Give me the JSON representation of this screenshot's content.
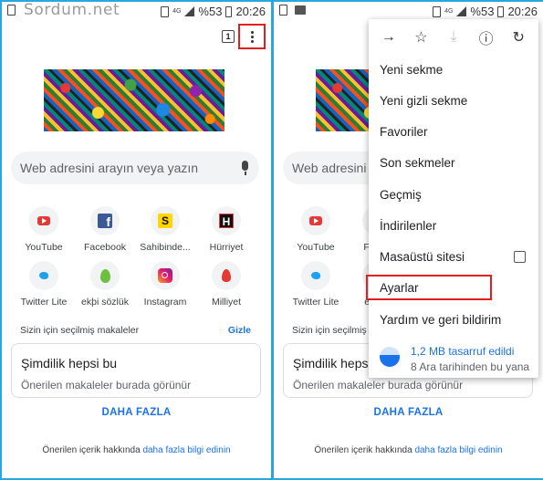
{
  "watermark": "Sordum.net",
  "status": {
    "battery_pct": "%53",
    "time": "20:26",
    "network": "4G"
  },
  "left": {
    "tab_count": "1",
    "search_placeholder": "Web adresini arayın veya yazın",
    "tiles": [
      {
        "label": "YouTube"
      },
      {
        "label": "Facebook"
      },
      {
        "label": "Sahibinde..."
      },
      {
        "label": "Hürriyet"
      },
      {
        "label": "Twitter Lite"
      },
      {
        "label": "ekþi sözlük"
      },
      {
        "label": "Instagram"
      },
      {
        "label": "Milliyet"
      }
    ],
    "section_title": "Sizin için seçilmiş makaleler",
    "hide_link": "Gizle",
    "card_title": "Şimdilik hepsi bu",
    "card_body": "Önerilen makaleler burada görünür",
    "more_button": "DAHA FAZLA",
    "footer_text": "Önerilen içerik hakkında ",
    "footer_link": "daha fazla bilgi edinin"
  },
  "right": {
    "search_placeholder": "Web adresini arayın",
    "tiles": [
      {
        "label": "YouTube"
      },
      {
        "label": "Faceb"
      },
      {
        "label": "Twitter Lite"
      },
      {
        "label": "ekþi s"
      }
    ],
    "section_title": "Sizin için seçilmiş makal",
    "card_title": "Şimdilik hepsi bu",
    "card_body": "Önerilen makaleler burada görünür",
    "more_button": "DAHA FAZLA",
    "footer_text": "Önerilen içerik hakkında ",
    "footer_link": "daha fazla bilgi edinin"
  },
  "menu": {
    "toolbar": [
      "forward-icon",
      "star-icon",
      "download-icon",
      "info-icon",
      "refresh-icon"
    ],
    "items": [
      {
        "label": "Yeni sekme"
      },
      {
        "label": "Yeni gizli sekme"
      },
      {
        "label": "Favoriler"
      },
      {
        "label": "Son sekmeler"
      },
      {
        "label": "Geçmiş"
      },
      {
        "label": "İndirilenler"
      },
      {
        "label": "Masaüstü sitesi"
      },
      {
        "label": "Ayarlar"
      },
      {
        "label": "Yardım ve geri bildirim"
      }
    ],
    "savings_title": "1,2 MB tasarruf edildi",
    "savings_sub": "8 Ara tarihinden bu yana"
  },
  "colors": {
    "accent": "#1a73e8",
    "highlight": "#e02020",
    "frame": "#29a8e0"
  }
}
